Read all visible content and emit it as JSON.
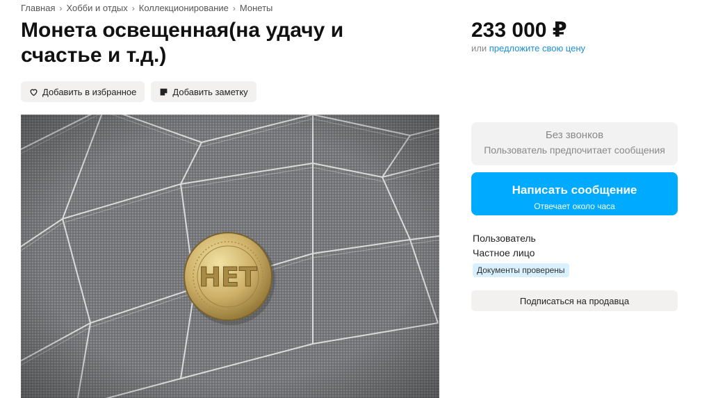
{
  "breadcrumb": [
    "Главная",
    "Хобби и отдых",
    "Коллекционирование",
    "Монеты"
  ],
  "listing": {
    "title": "Монета освещенная(на удачу и счастье и т.д.)",
    "price": "233 000 ₽",
    "offer_prefix": "или",
    "offer_link": "предложите свою цену"
  },
  "actions": {
    "favorite": "Добавить в избранное",
    "note": "Добавить заметку"
  },
  "photo": {
    "coin_text": "НЕТ"
  },
  "contact": {
    "no_calls_title": "Без звонков",
    "no_calls_subtitle": "Пользователь предпочитает сообщения",
    "message_button": "Написать сообщение",
    "message_subtitle": "Отвечает около часа"
  },
  "seller": {
    "name": "Пользователь",
    "type": "Частное лицо",
    "badge": "Документы проверены",
    "subscribe": "Подписаться на продавца"
  },
  "colors": {
    "accent": "#00aaff",
    "link": "#1a8fd8",
    "badge_bg": "#d9f0ff"
  }
}
